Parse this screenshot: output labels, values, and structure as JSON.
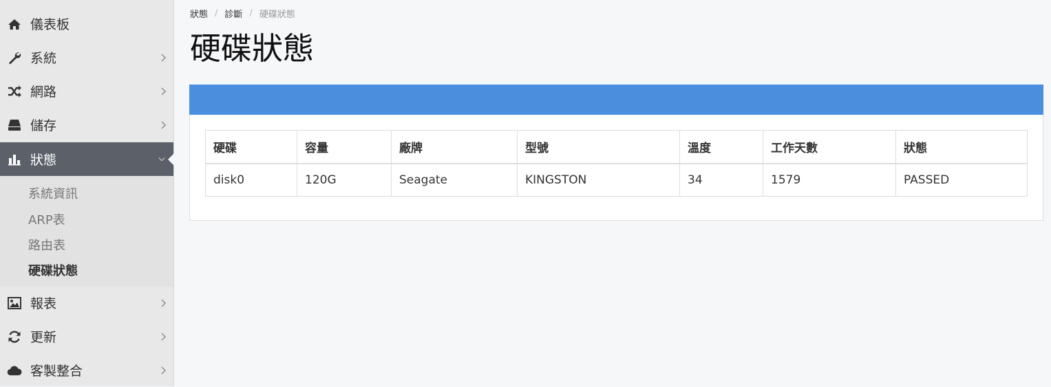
{
  "sidebar": {
    "items": [
      {
        "label": "儀表板",
        "icon": "home-icon"
      },
      {
        "label": "系統",
        "icon": "wrench-icon"
      },
      {
        "label": "網路",
        "icon": "shuffle-icon"
      },
      {
        "label": "儲存",
        "icon": "hard-drive-icon"
      },
      {
        "label": "狀態",
        "icon": "bar-chart-icon"
      },
      {
        "label": "報表",
        "icon": "image-icon"
      },
      {
        "label": "更新",
        "icon": "refresh-icon"
      },
      {
        "label": "客製整合",
        "icon": "cloud-icon"
      }
    ],
    "submenu": [
      "系統資訊",
      "ARP表",
      "路由表",
      "硬碟狀態"
    ]
  },
  "breadcrumb": [
    "狀態",
    "診斷",
    "硬碟狀態"
  ],
  "page": {
    "title": "硬碟狀態"
  },
  "table": {
    "headers": [
      "硬碟",
      "容量",
      "廠牌",
      "型號",
      "溫度",
      "工作天數",
      "狀態"
    ],
    "rows": [
      [
        "disk0",
        "120G",
        "Seagate",
        "KINGSTON",
        "34",
        "1579",
        "PASSED"
      ]
    ]
  },
  "colors": {
    "accent": "#4c8ede",
    "active_nav": "#5b6069"
  }
}
